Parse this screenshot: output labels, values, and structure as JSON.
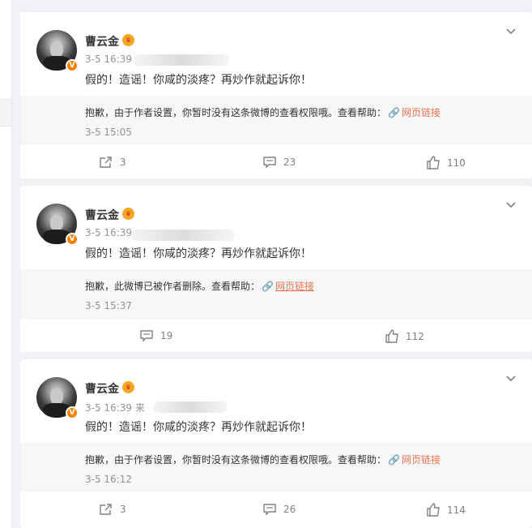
{
  "posts": [
    {
      "author": "曹云金",
      "date": "3-5 16:39",
      "text": "假的！造谣！你咸的淡疼？再炒作就起诉你！",
      "repost": {
        "message": "抱歉，由于作者设置，你暂时没有这条微博的查看权限哦。查看帮助：",
        "link": "网页链接",
        "time": "3-5 15:05"
      },
      "actions": {
        "share": "3",
        "comment": "23",
        "like": "110"
      }
    },
    {
      "author": "曹云金",
      "date": "3-5 16:39",
      "text": "假的！造谣！你咸的淡疼？再炒作就起诉你！",
      "repost": {
        "message": "抱歉，此微博已被作者删除。查看帮助：",
        "link": "网页链接",
        "time": "3-5 15:37"
      },
      "actions": {
        "comment": "19",
        "like": "112"
      }
    },
    {
      "author": "曹云金",
      "date": "3-5 16:39",
      "source_prefix": "来",
      "text": "假的！造谣！你咸的淡疼？再炒作就起诉你！",
      "repost": {
        "message": "抱歉，由于作者设置，你暂时没有这条微博的查看权限哦。查看帮助：",
        "link": "网页链接",
        "time": "3-5 16:12"
      },
      "actions": {
        "share": "3",
        "comment": "26",
        "like": "114"
      }
    }
  ],
  "colors": {
    "accent_link": "#eb7350",
    "verified_badge": "#f78100",
    "page_bg": "#f1f2f5"
  },
  "icons": {
    "verified": "v-badge-icon",
    "crown": "crown-badge-icon",
    "menu": "chevron-down-icon",
    "share": "share-icon",
    "comment": "comment-icon",
    "like": "thumbs-up-icon",
    "link": "link-icon"
  },
  "labels": {
    "verified_letter": "V",
    "crown_glyph": "♛",
    "link_glyph": "🔗"
  }
}
